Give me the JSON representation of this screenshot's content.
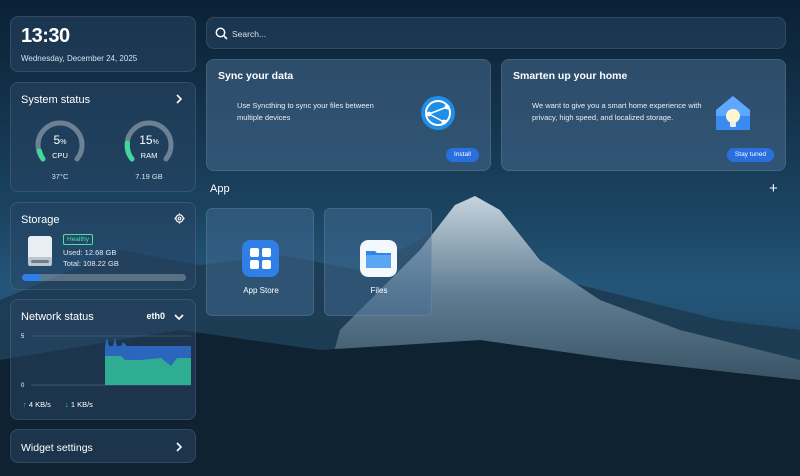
{
  "clock": {
    "time": "13:30",
    "date": "Wednesday, December 24, 2025"
  },
  "system_status": {
    "title": "System status",
    "cpu": {
      "value": "5",
      "unit": "%",
      "label": "CPU",
      "sub": "37°C",
      "percent": 5
    },
    "ram": {
      "value": "15",
      "unit": "%",
      "label": "RAM",
      "sub": "7.19 GB",
      "percent": 15
    }
  },
  "storage": {
    "title": "Storage",
    "health": "Healthy",
    "used": "Used: 12.68 GB",
    "total": "Total: 108.22 GB",
    "used_fraction": 0.117
  },
  "network": {
    "title": "Network status",
    "interface": "eth0",
    "y_ticks": [
      "5",
      "0"
    ],
    "upload": "4 KB/s",
    "download": "1 KB/s"
  },
  "widget_settings": {
    "title": "Widget settings"
  },
  "search": {
    "placeholder": "Search..."
  },
  "promos": [
    {
      "title": "Sync your data",
      "description": "Use Syncthing to sync your files between multiple devices",
      "button": "Install"
    },
    {
      "title": "Smarten up your home",
      "description": "We want to give you a smart home experience with privacy, high speed, and localized storage.",
      "button": "Stay tuned"
    }
  ],
  "apps": {
    "heading": "App",
    "items": [
      {
        "label": "App Store",
        "icon": "app-store-icon"
      },
      {
        "label": "Files",
        "icon": "folder-icon"
      }
    ]
  },
  "colors": {
    "accent": "#2a6fe0",
    "gauge_green": "#3fd99b",
    "healthy": "#4fe0a8",
    "upload_arrow": "#3aa0ff",
    "download_arrow": "#3fd99b"
  }
}
